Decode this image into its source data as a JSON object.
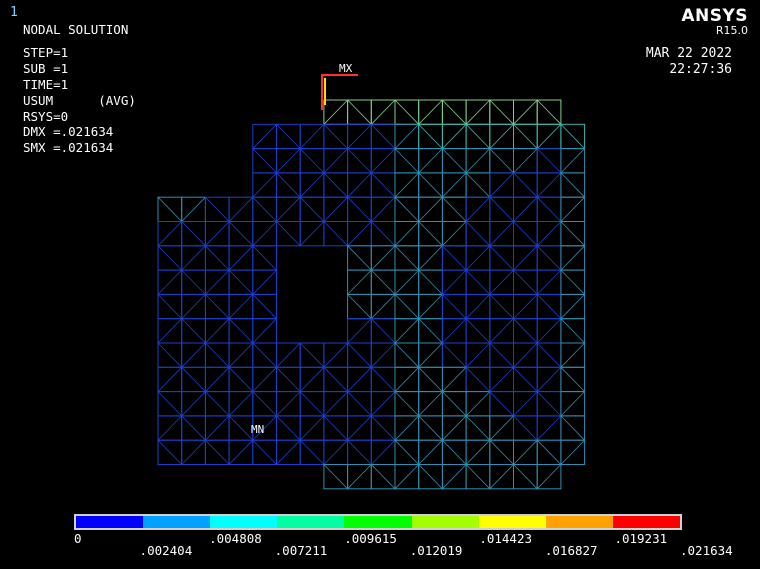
{
  "window": {
    "number": "1"
  },
  "brand": {
    "name": "ANSYS",
    "release": "R15.0"
  },
  "datetime": {
    "date": "MAR 22 2022",
    "time": "22:27:36"
  },
  "info": {
    "title": "NODAL SOLUTION",
    "step": "STEP=1",
    "sub": "SUB =1",
    "time": "TIME=1",
    "usum": "USUM      (AVG)",
    "rsys": "RSYS=0",
    "dmx": "DMX =.021634",
    "smx": "SMX =.021634"
  },
  "markers": {
    "max": "MX",
    "min": "MN"
  },
  "legend": {
    "colors": [
      "#0000ff",
      "#00a2ff",
      "#00ffff",
      "#00ffa2",
      "#00ff00",
      "#a2ff00",
      "#ffff00",
      "#ffa200",
      "#ff0000"
    ],
    "labels_top": [
      "0",
      ".004808",
      ".009615",
      ".014423",
      ".019231"
    ],
    "labels_bottom": [
      ".002404",
      ".007211",
      ".012019",
      ".016827",
      ".021634"
    ]
  }
}
